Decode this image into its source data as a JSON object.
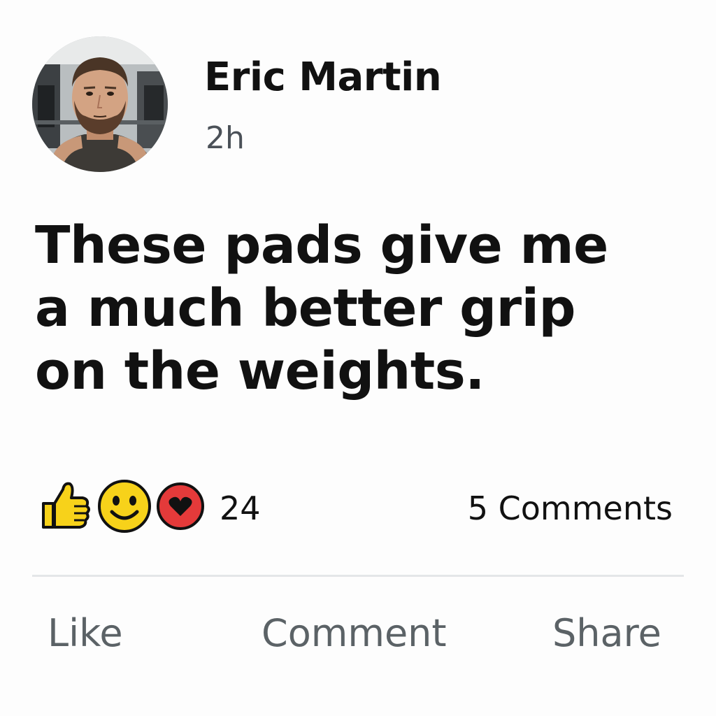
{
  "post": {
    "author": {
      "name": "Eric Martin",
      "avatar": "avatar-photo"
    },
    "timestamp": "2h",
    "text": "These pads give me\na much better grip\non the weights."
  },
  "reactions": {
    "icons": [
      "thumbs-up-icon",
      "smile-icon",
      "heart-icon"
    ],
    "count": "24"
  },
  "comments_count_label": "5 Comments",
  "actions": {
    "like": "Like",
    "comment": "Comment",
    "share": "Share"
  },
  "colors": {
    "like_yellow": "#f7d21a",
    "heart_red": "#e43a3a",
    "muted_text": "#5b6266"
  }
}
